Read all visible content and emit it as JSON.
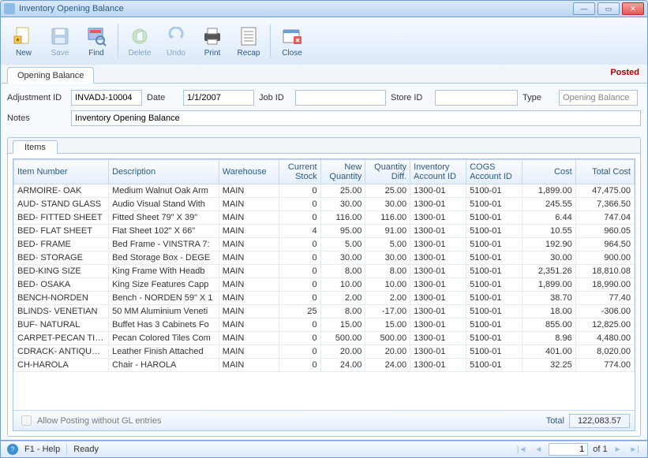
{
  "window": {
    "title": "Inventory Opening Balance"
  },
  "toolbar": {
    "new": "New",
    "save": "Save",
    "find": "Find",
    "delete": "Delete",
    "undo": "Undo",
    "print": "Print",
    "recap": "Recap",
    "close": "Close"
  },
  "tab_opening": "Opening Balance",
  "posted_label": "Posted",
  "form": {
    "adjustment_id_label": "Adjustment ID",
    "adjustment_id": "INVADJ-10004",
    "date_label": "Date",
    "date": "1/1/2007",
    "job_id_label": "Job ID",
    "job_id": "",
    "store_id_label": "Store ID",
    "store_id": "",
    "type_label": "Type",
    "type": "Opening Balance",
    "notes_label": "Notes",
    "notes": "Inventory Opening Balance"
  },
  "items_tab": "Items",
  "columns": {
    "item_number": "Item Number",
    "description": "Description",
    "warehouse": "Warehouse",
    "current_stock": "Current Stock",
    "new_qty": "New Quantity",
    "qty_diff": "Quantity Diff.",
    "inv_acct": "Inventory Account ID",
    "cogs_acct": "COGS Account ID",
    "cost": "Cost",
    "total_cost": "Total Cost"
  },
  "rows": [
    {
      "item": "ARMOIRE- OAK",
      "desc": "Medium Walnut Oak Arm",
      "wh": "MAIN",
      "cur": "0",
      "newq": "25.00",
      "diff": "25.00",
      "inv": "1300-01",
      "cogs": "5100-01",
      "cost": "1,899.00",
      "tot": "47,475.00"
    },
    {
      "item": "AUD- STAND GLASS",
      "desc": "Audio Visual Stand With",
      "wh": "MAIN",
      "cur": "0",
      "newq": "30.00",
      "diff": "30.00",
      "inv": "1300-01",
      "cogs": "5100-01",
      "cost": "245.55",
      "tot": "7,366.50"
    },
    {
      "item": "BED- FITTED SHEET",
      "desc": "Fitted Sheet 79\" X 39\"",
      "wh": "MAIN",
      "cur": "0",
      "newq": "116.00",
      "diff": "116.00",
      "inv": "1300-01",
      "cogs": "5100-01",
      "cost": "6.44",
      "tot": "747.04"
    },
    {
      "item": "BED- FLAT SHEET",
      "desc": "Flat Sheet 102\" X 66\"",
      "wh": "MAIN",
      "cur": "4",
      "newq": "95.00",
      "diff": "91.00",
      "inv": "1300-01",
      "cogs": "5100-01",
      "cost": "10.55",
      "tot": "960.05"
    },
    {
      "item": "BED- FRAME",
      "desc": "Bed Frame - VINSTRA 7:",
      "wh": "MAIN",
      "cur": "0",
      "newq": "5.00",
      "diff": "5.00",
      "inv": "1300-01",
      "cogs": "5100-01",
      "cost": "192.90",
      "tot": "964.50"
    },
    {
      "item": "BED- STORAGE",
      "desc": "Bed Storage Box - DEGE",
      "wh": "MAIN",
      "cur": "0",
      "newq": "30.00",
      "diff": "30.00",
      "inv": "1300-01",
      "cogs": "5100-01",
      "cost": "30.00",
      "tot": "900.00"
    },
    {
      "item": "BED-KING SIZE",
      "desc": "King Frame With  Headb",
      "wh": "MAIN",
      "cur": "0",
      "newq": "8.00",
      "diff": "8.00",
      "inv": "1300-01",
      "cogs": "5100-01",
      "cost": "2,351.26",
      "tot": "18,810.08"
    },
    {
      "item": "BED- OSAKA",
      "desc": "King Size Features Capp",
      "wh": "MAIN",
      "cur": "0",
      "newq": "10.00",
      "diff": "10.00",
      "inv": "1300-01",
      "cogs": "5100-01",
      "cost": "1,899.00",
      "tot": "18,990.00"
    },
    {
      "item": "BENCH-NORDEN",
      "desc": "Bench - NORDEN 59\" X 1",
      "wh": "MAIN",
      "cur": "0",
      "newq": "2.00",
      "diff": "2.00",
      "inv": "1300-01",
      "cogs": "5100-01",
      "cost": "38.70",
      "tot": "77.40"
    },
    {
      "item": "BLINDS- VENETIAN",
      "desc": "50 MM Aluminium Veneti",
      "wh": "MAIN",
      "cur": "25",
      "newq": "8.00",
      "diff": "-17.00",
      "inv": "1300-01",
      "cogs": "5100-01",
      "cost": "18.00",
      "tot": "-306.00"
    },
    {
      "item": "BUF- NATURAL",
      "desc": "Buffet Has 3 Cabinets Fo",
      "wh": "MAIN",
      "cur": "0",
      "newq": "15.00",
      "diff": "15.00",
      "inv": "1300-01",
      "cogs": "5100-01",
      "cost": "855.00",
      "tot": "12,825.00"
    },
    {
      "item": "CARPET-PECAN TILE",
      "desc": "Pecan Colored Tiles Com",
      "wh": "MAIN",
      "cur": "0",
      "newq": "500.00",
      "diff": "500.00",
      "inv": "1300-01",
      "cogs": "5100-01",
      "cost": "8.96",
      "tot": "4,480.00"
    },
    {
      "item": "CDRACK- ANTIQUE BR.",
      "desc": "Leather Finish Attached",
      "wh": "MAIN",
      "cur": "0",
      "newq": "20.00",
      "diff": "20.00",
      "inv": "1300-01",
      "cogs": "5100-01",
      "cost": "401.00",
      "tot": "8,020.00"
    },
    {
      "item": "CH-HAROLA",
      "desc": "Chair - HAROLA",
      "wh": "MAIN",
      "cur": "0",
      "newq": "24.00",
      "diff": "24.00",
      "inv": "1300-01",
      "cogs": "5100-01",
      "cost": "32.25",
      "tot": "774.00"
    }
  ],
  "footer": {
    "allow_posting": "Allow Posting without GL entries",
    "total_label": "Total",
    "total_value": "122,083.57"
  },
  "status": {
    "help": "F1 - Help",
    "ready": "Ready",
    "page": "1",
    "of": "of  1"
  }
}
